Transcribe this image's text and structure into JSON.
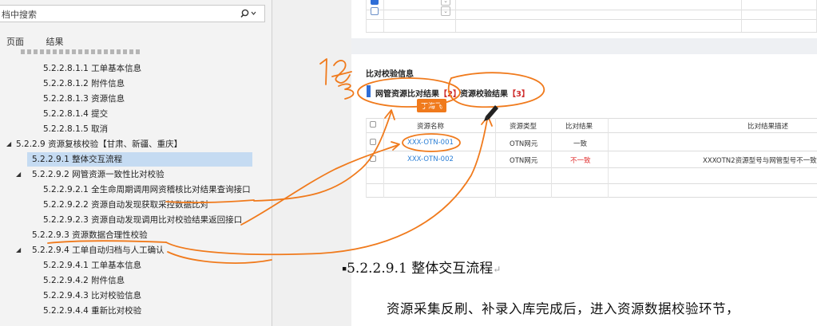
{
  "nav": {
    "search_text": "档中搜索",
    "tabs": [
      "页面",
      "结果"
    ],
    "tree": [
      {
        "label": "5.2.2.8.1.1 工单基本信息",
        "indent": 3
      },
      {
        "label": "5.2.2.8.1.2 附件信息",
        "indent": 3
      },
      {
        "label": "5.2.2.8.1.3 资源信息",
        "indent": 3
      },
      {
        "label": "5.2.2.8.1.4 提交",
        "indent": 3
      },
      {
        "label": "5.2.2.8.1.5 取消",
        "indent": 3
      },
      {
        "label": "5.2.2.9 资源复核校验【甘肃、新疆、重庆】",
        "indent": 0,
        "expand": true
      },
      {
        "label": "5.2.2.9.1 整体交互流程",
        "indent": 1,
        "selected": true
      },
      {
        "label": "5.2.2.9.2 网管资源一致性比对校验",
        "indent": 1,
        "expand": true
      },
      {
        "label": "5.2.2.9.2.1 全生命周期调用网资稽核比对结果查询接口",
        "indent": 2
      },
      {
        "label": "5.2.2.9.2.2 资源自动发现获取采控数据比对",
        "indent": 2
      },
      {
        "label": "5.2.2.9.2.3 资源自动发现调用比对校验结果返回接口",
        "indent": 2
      },
      {
        "label": "5.2.2.9.3 资源数据合理性校验",
        "indent": 1
      },
      {
        "label": "5.2.2.9.4 工单自动归档与人工确认",
        "indent": 1,
        "expand": true
      },
      {
        "label": "5.2.2.9.4.1 工单基本信息",
        "indent": 2
      },
      {
        "label": "5.2.2.9.4.2 附件信息",
        "indent": 2
      },
      {
        "label": "5.2.2.9.4.3 比对校验信息",
        "indent": 2
      },
      {
        "label": "5.2.2.9.4.4 重新比对校验",
        "indent": 2
      }
    ]
  },
  "doc": {
    "section_title": "比对校验信息",
    "tab1": {
      "label": "网管资源比对结果",
      "count": "【2】"
    },
    "tab2": {
      "label": "资源校验结果",
      "count": "【3】"
    },
    "tooltip": "丁海飞",
    "table": {
      "headers": [
        "资源名称",
        "资源类型",
        "比对结果",
        "比对结果描述"
      ],
      "rows": [
        {
          "name": "XXX-OTN-001",
          "type": "OTN网元",
          "result": "一致",
          "desc": ""
        },
        {
          "name": "XXX-OTN-002",
          "type": "OTN网元",
          "result": "不一致",
          "desc": "XXXOTN2资源型号与网管型号不一致"
        }
      ]
    },
    "heading": "5.2.2.9.1 整体交互流程",
    "body": "资源采集反刷、补录入库完成后，进入资源数据校验环节，",
    "handwriting": "1&2"
  },
  "colors": {
    "accent": "#2f6ed7",
    "annotation": "#f07a1c",
    "link": "#2b7fd6",
    "error": "#e03030"
  }
}
